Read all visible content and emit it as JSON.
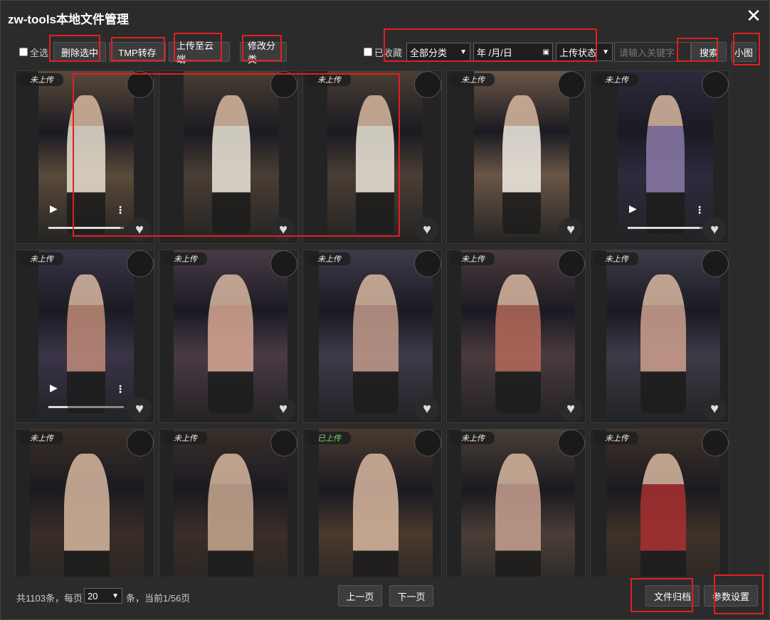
{
  "window": {
    "title": "zw-tools本地文件管理"
  },
  "toolbar": {
    "select_all_label": "全选",
    "delete_label": "删除选中",
    "tmp_label": "TMP转存",
    "upload_label": "上传至云端",
    "modify_label": "修改分类",
    "favorite_label": "已收藏",
    "category_value": "全部分类",
    "date_placeholder": "年 /月/日",
    "upload_status_value": "上传状态",
    "keyword_placeholder": "请输入关键字",
    "search_label": "搜索",
    "view_label": "小图"
  },
  "cards": [
    {
      "status": "未上传",
      "video": true,
      "progress": 0.95,
      "tone": "#5a4a3a",
      "accent": "#e8e0d0"
    },
    {
      "status": "",
      "video": false,
      "progress": null,
      "tone": "#4a3e34",
      "accent": "#ece6da"
    },
    {
      "status": "未上传",
      "video": false,
      "progress": null,
      "tone": "#4a3e34",
      "accent": "#ece6da"
    },
    {
      "status": "未上传",
      "video": false,
      "progress": null,
      "tone": "#6a5646",
      "accent": "#f2ede4"
    },
    {
      "status": "未上传",
      "video": true,
      "progress": 0.95,
      "tone": "#2e2a3e",
      "accent": "#8a7aa8"
    },
    {
      "status": "未上传",
      "video": true,
      "progress": 0.25,
      "tone": "#3a3448",
      "accent": "#c08a78"
    },
    {
      "status": "未上传",
      "video": false,
      "progress": null,
      "tone": "#4a3a46",
      "accent": "#d8a894"
    },
    {
      "status": "未上传",
      "video": false,
      "progress": null,
      "tone": "#3e3a4a",
      "accent": "#c29a8a"
    },
    {
      "status": "未上传",
      "video": false,
      "progress": null,
      "tone": "#4a3a3e",
      "accent": "#b46a5a"
    },
    {
      "status": "未上传",
      "video": false,
      "progress": null,
      "tone": "#3e3a48",
      "accent": "#d0a090"
    },
    {
      "status": "未上传",
      "video": false,
      "progress": null,
      "tone": "#3a2e26",
      "accent": "#d8b8a0"
    },
    {
      "status": "未上传",
      "video": false,
      "progress": null,
      "tone": "#3a2e28",
      "accent": "#c8a890"
    },
    {
      "status": "已上传",
      "video": false,
      "progress": null,
      "tone": "#4a3a2e",
      "accent": "#d8b8a0"
    },
    {
      "status": "未上传",
      "video": false,
      "progress": null,
      "tone": "#4a3e36",
      "accent": "#c8a090"
    },
    {
      "status": "未上传",
      "video": false,
      "progress": null,
      "tone": "#3e3228",
      "accent": "#a83030"
    }
  ],
  "footer": {
    "summary_prefix": "共1103条，每页",
    "page_size": "20",
    "summary_suffix": "条，当前1/56页",
    "prev_label": "上一页",
    "next_label": "下一页",
    "archive_label": "文件归档",
    "settings_label": "参数设置"
  },
  "colors": {
    "highlight": "#e02020",
    "uploaded": "#6fdc6f"
  }
}
